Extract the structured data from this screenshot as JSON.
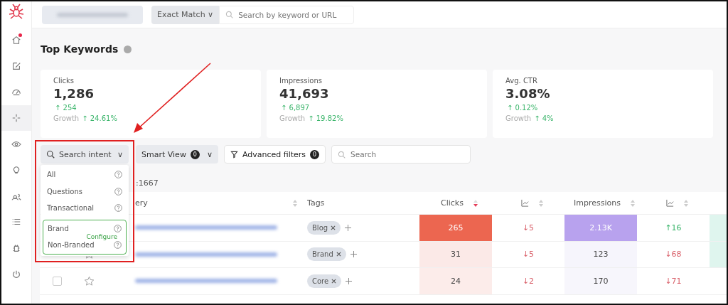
{
  "sidebar": {
    "items": [
      {
        "selected": false,
        "badge": true
      },
      {
        "selected": false,
        "badge": false
      },
      {
        "selected": false,
        "badge": false
      },
      {
        "selected": true,
        "badge": false
      },
      {
        "selected": false,
        "badge": false
      },
      {
        "selected": false,
        "badge": false
      },
      {
        "selected": false,
        "badge": false
      },
      {
        "selected": false,
        "badge": false
      },
      {
        "selected": false,
        "badge": false
      },
      {
        "selected": false,
        "badge": false
      }
    ]
  },
  "topbar": {
    "match_type": "Exact Match",
    "chevron": "∨",
    "search": {
      "placeholder": "Search by keyword or URL"
    }
  },
  "title": "Top Keywords",
  "cards": [
    {
      "label": "Clicks",
      "value": "1,286",
      "delta": "↑ 254",
      "growth_label": "Growth",
      "growth": "↑ 24.61%"
    },
    {
      "label": "Impressions",
      "value": "41,693",
      "delta": "↑ 6,897",
      "growth_label": "Growth",
      "growth": "↑ 19.82%"
    },
    {
      "label": "Avg. CTR",
      "value": "3.08%",
      "delta": "↑ 0.12%",
      "growth_label": "Growth",
      "growth": "↑ 4%"
    }
  ],
  "filters": {
    "intent": {
      "label": "Search intent",
      "chevron": "∨"
    },
    "smart_view": {
      "label": "Smart View",
      "count": "0",
      "chevron": "∨"
    },
    "advanced": {
      "label": "Advanced filters",
      "count": "0"
    },
    "search": {
      "placeholder": "Search"
    }
  },
  "intent_menu": {
    "items": [
      {
        "label": "All"
      },
      {
        "label": "Questions"
      },
      {
        "label": "Transactional"
      }
    ],
    "brand_items": [
      {
        "label": "Brand"
      },
      {
        "label": "Non-Branded"
      }
    ],
    "configure": "Configure"
  },
  "total": ":1667",
  "table": {
    "columns": [
      "ery",
      "Tags",
      "Clicks",
      "Impressions"
    ],
    "rows": [
      {
        "tag": "Blog",
        "clicks": {
          "value": "265",
          "color": "#ec6650"
        },
        "clicks_delta": {
          "value": "↓5",
          "positive": false
        },
        "impressions": {
          "value": "2.13K",
          "color": "#b8a2ee"
        },
        "impressions_delta": {
          "value": "↑16",
          "positive": true
        },
        "column_9": {
          "color": "#dff5ee"
        }
      },
      {
        "tag": "Brand",
        "clicks": {
          "value": "31",
          "color": "#fbe9e7"
        },
        "clicks_delta": {
          "value": "↓5",
          "positive": false
        },
        "impressions": {
          "value": "123",
          "color": "#f6f5fc"
        },
        "impressions_delta": {
          "value": "↓68",
          "positive": false
        },
        "column_9": {
          "color": "#dff5ee"
        }
      },
      {
        "checked": false,
        "tag": "Core",
        "clicks": {
          "value": "24",
          "color": "#fcecea"
        },
        "clicks_delta": {
          "value": "↓2",
          "positive": false
        },
        "impressions": {
          "value": "170",
          "color": "#f7f6fc"
        },
        "impressions_delta": {
          "value": "↓71",
          "positive": false
        }
      }
    ]
  }
}
